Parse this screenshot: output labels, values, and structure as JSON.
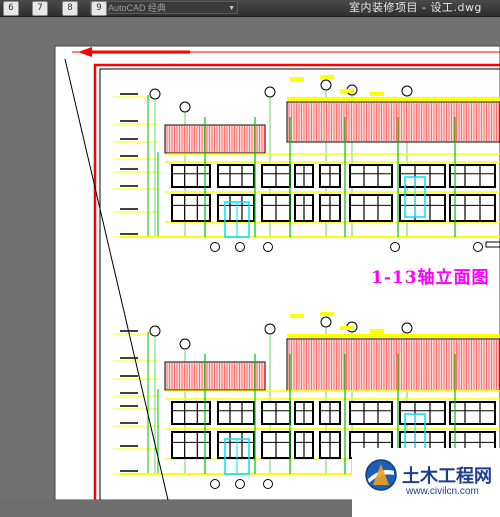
{
  "titlebar": {
    "quick_buttons": [
      "6",
      "7",
      "8",
      "9"
    ],
    "workspace": "AutoCAD 经典",
    "app_title": "室内装修项目 - 设工.dwg"
  },
  "drawing": {
    "elevation_title": "1-13轴立面图",
    "colors": {
      "paper": "#ffffff",
      "border_red": "#ff0000",
      "yellow": "#ffff00",
      "green": "#00c000",
      "cyan": "#00e0ff",
      "magenta": "#ff00ff",
      "hatch_red": "#ff4040",
      "black": "#000000"
    }
  },
  "watermark": {
    "name": "土木工程网",
    "url": "www.civilcn.com"
  }
}
